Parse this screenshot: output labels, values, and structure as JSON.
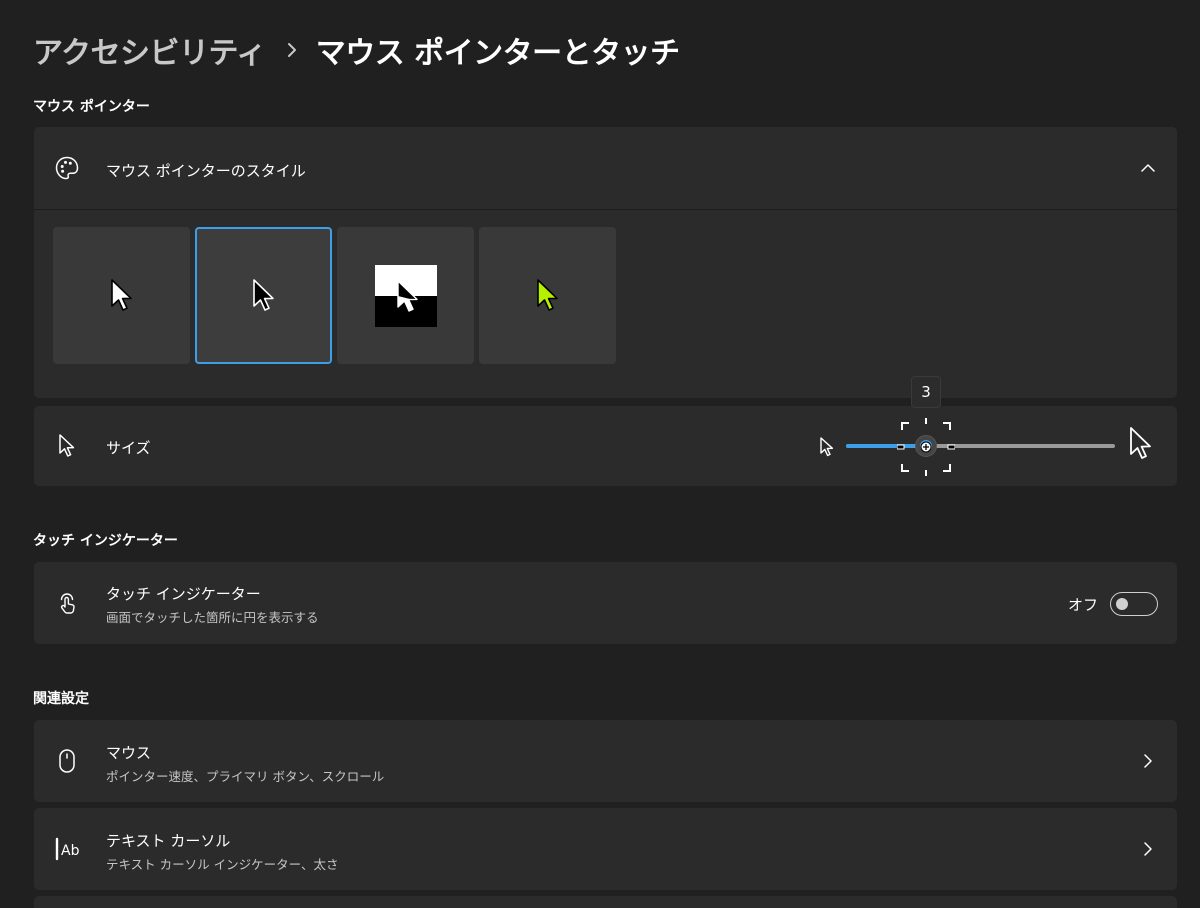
{
  "breadcrumb": {
    "parent": "アクセシビリティ",
    "separator": "chevron-right-icon",
    "current": "マウス ポインターとタッチ"
  },
  "sections": {
    "mouse_pointer": "マウス ポインター",
    "touch_indicator": "タッチ インジケーター",
    "related": "関連設定"
  },
  "pointer_style": {
    "title": "マウス ポインターのスタイル",
    "icon": "palette-icon",
    "expanded_icon": "chevron-up-icon",
    "options": [
      {
        "id": "white",
        "selected": false,
        "cursor_color": "#ffffff",
        "outline": "#000000"
      },
      {
        "id": "black",
        "selected": true,
        "cursor_color": "#000000",
        "outline": "#ffffff"
      },
      {
        "id": "inverted",
        "selected": false,
        "cursor_color": "#ffffff",
        "outline": "#000000"
      },
      {
        "id": "custom",
        "selected": false,
        "cursor_color": "#b5f000",
        "outline": "#000000"
      }
    ],
    "selected_accent": "#3c9fe8"
  },
  "size": {
    "title": "サイズ",
    "icon": "pointer-icon",
    "value": 3,
    "min": 1,
    "max": 15,
    "tooltip": "3",
    "accent": "#3c9fe8"
  },
  "touch": {
    "title": "タッチ インジケーター",
    "subtitle": "画面でタッチした箇所に円を表示する",
    "icon": "touch-icon",
    "toggle_label": "オフ",
    "toggle_on": false
  },
  "related": [
    {
      "title": "マウス",
      "subtitle": "ポインター速度、プライマリ ボタン、スクロール",
      "icon": "mouse-icon"
    },
    {
      "title": "テキスト カーソル",
      "subtitle": "テキスト カーソル インジケーター、太さ",
      "icon": "text-cursor-icon"
    }
  ]
}
